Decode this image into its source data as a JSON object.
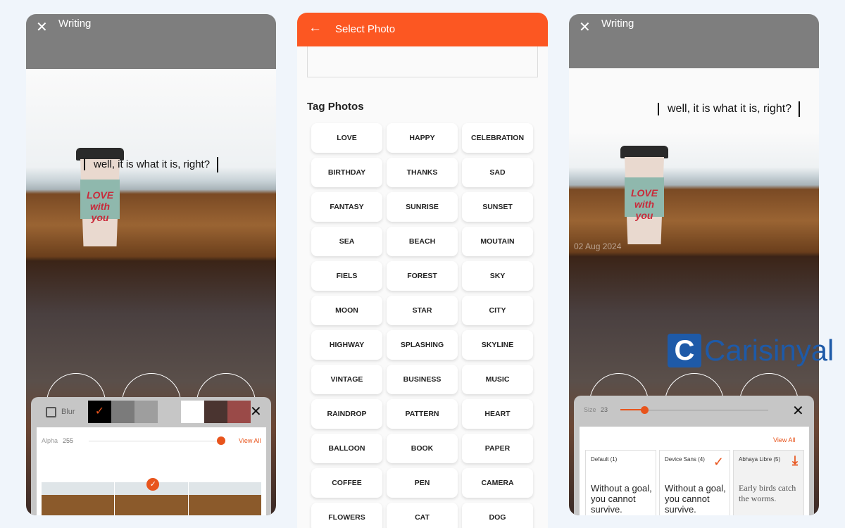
{
  "left": {
    "title": "Writing",
    "close_icon": "close-icon",
    "caption": "well, it is what it is, right?",
    "blur_label": "Blur",
    "blur_checked": false,
    "alpha_label": "Alpha",
    "alpha_value": "255",
    "alpha_fraction": 1.0,
    "view_all": "View All",
    "swatches": [
      "#000000",
      "#7b7b7b",
      "#9e9e9e",
      "#c6c6c6",
      "#ffffff",
      "#4a3430",
      "#9a4a48"
    ],
    "selected_swatch": "#000000",
    "cup_text": "LOVE with you"
  },
  "middle": {
    "title": "Select Photo",
    "section": "Tag Photos",
    "accent": "#fc5722",
    "tags": [
      "LOVE",
      "HAPPY",
      "CELEBRATION",
      "BIRTHDAY",
      "THANKS",
      "SAD",
      "FANTASY",
      "SUNRISE",
      "SUNSET",
      "SEA",
      "BEACH",
      "MOUTAIN",
      "FIELS",
      "FOREST",
      "SKY",
      "MOON",
      "STAR",
      "CITY",
      "HIGHWAY",
      "SPLASHING",
      "SKYLINE",
      "VINTAGE",
      "BUSINESS",
      "MUSIC",
      "RAINDROP",
      "PATTERN",
      "HEART",
      "BALLOON",
      "BOOK",
      "PAPER",
      "COFFEE",
      "PEN",
      "CAMERA",
      "FLOWERS",
      "CAT",
      "DOG"
    ]
  },
  "right": {
    "title": "Writing",
    "caption": "well, it is what it is, right?",
    "date": "02 Aug 2024",
    "size_label": "Size",
    "size_value": "23",
    "view_all": "View All",
    "fonts": [
      {
        "name": "Default (1)",
        "sample": "Without a goal, you cannot survive.",
        "status": ""
      },
      {
        "name": "Device Sans (4)",
        "sample": "Without a goal, you cannot survive.",
        "status": "selected"
      },
      {
        "name": "Abhaya Libre (5)",
        "sample": "Early birds catch the worms.",
        "status": "download"
      }
    ]
  },
  "watermark": "Carisinyal"
}
